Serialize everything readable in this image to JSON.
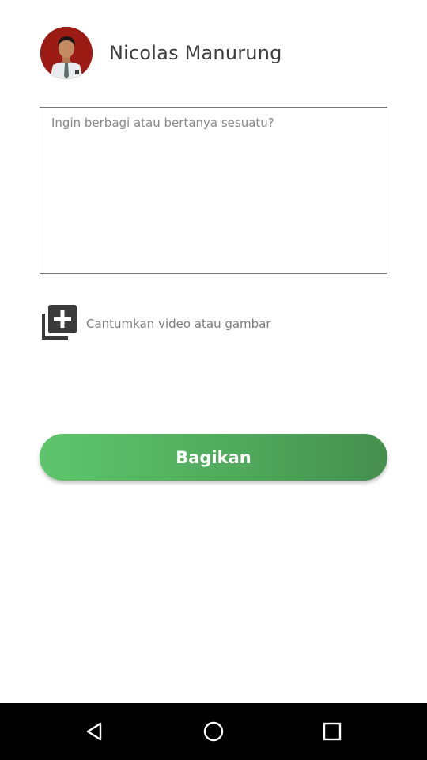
{
  "user": {
    "name": "Nicolas Manurung",
    "avatar_bg": "#9c1b14"
  },
  "post": {
    "placeholder": "Ingin berbagi atau bertanya sesuatu?",
    "value": ""
  },
  "attach": {
    "icon": "add-to-library-icon",
    "label": "Cantumkan video atau gambar"
  },
  "share_button": {
    "label": "Bagikan",
    "color_start": "#5fc56d",
    "color_end": "#468e4f"
  },
  "nav": {
    "back_icon": "back-triangle-icon",
    "home_icon": "home-circle-icon",
    "recents_icon": "recents-square-icon"
  }
}
